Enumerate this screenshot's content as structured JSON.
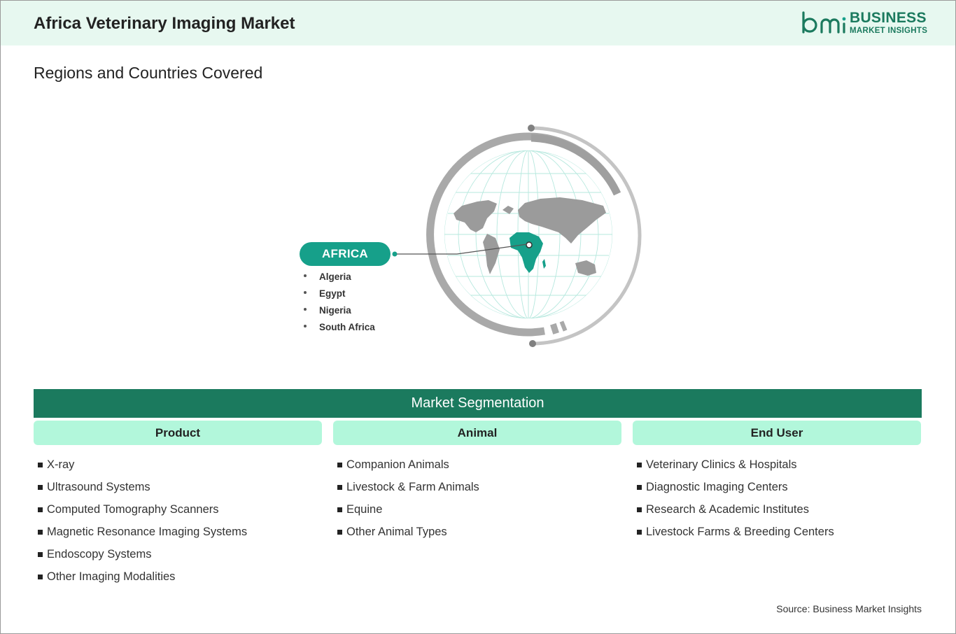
{
  "header": {
    "title": "Africa Veterinary Imaging Market",
    "logo_mark": "bmi",
    "logo_line1": "BUSINESS",
    "logo_line2": "MARKET INSIGHTS"
  },
  "regions": {
    "heading": "Regions and Countries Covered",
    "region_label": "AFRICA",
    "countries": [
      "Algeria",
      "Egypt",
      "Nigeria",
      "South Africa"
    ]
  },
  "segmentation": {
    "heading": "Market Segmentation",
    "columns": [
      {
        "title": "Product",
        "items": [
          "X-ray",
          "Ultrasound Systems",
          "Computed Tomography Scanners",
          "Magnetic Resonance Imaging Systems",
          "Endoscopy Systems",
          "Other Imaging Modalities"
        ]
      },
      {
        "title": "Animal",
        "items": [
          "Companion Animals",
          "Livestock & Farm Animals",
          "Equine",
          "Other Animal Types"
        ]
      },
      {
        "title": "End User",
        "items": [
          "Veterinary Clinics & Hospitals",
          "Diagnostic Imaging Centers",
          "Research & Academic Institutes",
          "Livestock Farms & Breeding Centers"
        ]
      }
    ]
  },
  "footer": {
    "source": "Source: Business Market Insights"
  },
  "colors": {
    "header_bg": "#e7f8f0",
    "brand_green": "#1b7a5e",
    "accent_teal": "#16a08a",
    "column_header_bg": "#b2f7db",
    "map_gray": "#9b9b9b"
  },
  "icons": [
    "globe-map-icon",
    "bmi-logo-icon",
    "bullet-square-icon"
  ]
}
